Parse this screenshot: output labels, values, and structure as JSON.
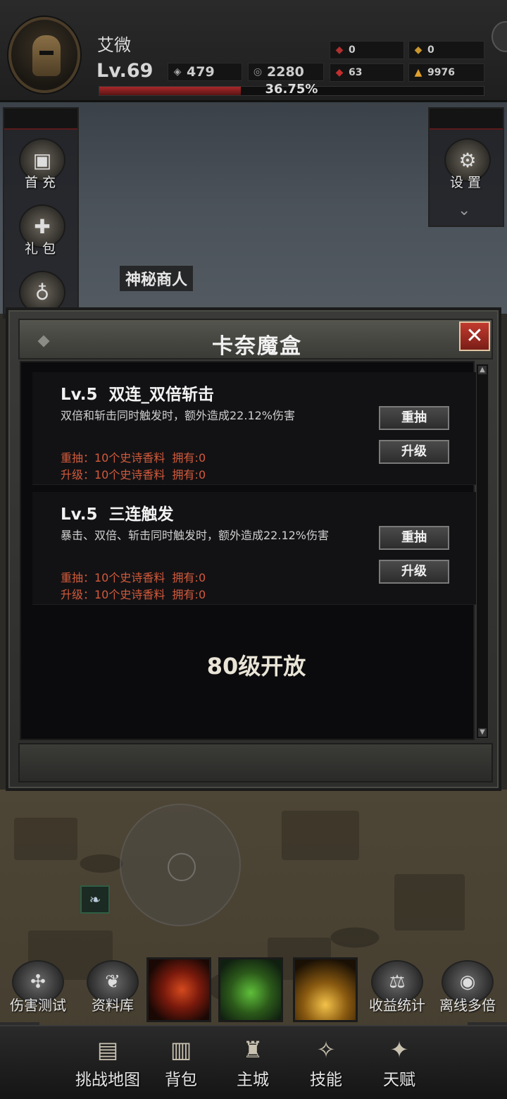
{
  "player": {
    "name": "艾微",
    "level": "Lv.69",
    "exp_percent": "36.75%",
    "exp_fraction": 0.3675
  },
  "resources": {
    "ticket": "479",
    "coin": "2280",
    "red_small": "0",
    "gold_small": "0",
    "red_large": "63",
    "gold_large": "9976"
  },
  "side_menu_left": [
    {
      "label": "首充",
      "icon": "chest-icon"
    },
    {
      "label": "礼包",
      "icon": "gift-icon"
    },
    {
      "label": "",
      "icon": "pouch-icon"
    }
  ],
  "side_menu_right": [
    {
      "label": "设置",
      "icon": "gear-icon"
    }
  ],
  "npc_label": "神秘商人",
  "dialog": {
    "title": "卡奈魔盒",
    "skills": [
      {
        "level": "Lv.5",
        "name": "双连_双倍斩击",
        "description": "双倍和斩击同时触发时，额外造成22.12%伤害",
        "reroll_cost": "重抽：10个史诗香料",
        "reroll_owned": "拥有:0",
        "upgrade_cost": "升级：10个史诗香料",
        "upgrade_owned": "拥有:0",
        "reroll_label": "重抽",
        "upgrade_label": "升级"
      },
      {
        "level": "Lv.5",
        "name": "三连触发",
        "description": "暴击、双倍、斩击同时触发时，额外造成22.12%伤害",
        "reroll_cost": "重抽：10个史诗香料",
        "reroll_owned": "拥有:0",
        "upgrade_cost": "升级：10个史诗香料",
        "upgrade_owned": "拥有:0",
        "reroll_label": "重抽",
        "upgrade_label": "升级"
      }
    ],
    "locked_text": "80级开放"
  },
  "bottom_actions": [
    {
      "label": "伤害测试",
      "icon": "target-icon"
    },
    {
      "label": "资料库",
      "icon": "book-icon"
    },
    {
      "label": "收益统计",
      "icon": "stats-icon"
    },
    {
      "label": "离线多倍",
      "icon": "eye-icon"
    }
  ],
  "nav": [
    {
      "label": "挑战地图",
      "icon": "map-icon"
    },
    {
      "label": "背包",
      "icon": "backpack-icon"
    },
    {
      "label": "主城",
      "icon": "castle-icon"
    },
    {
      "label": "技能",
      "icon": "skill-icon"
    },
    {
      "label": "天赋",
      "icon": "talent-icon"
    }
  ],
  "colors": {
    "cost_text": "#d35a3a",
    "close_button": "#c23a2e",
    "exp_fill": "#a8282a"
  }
}
